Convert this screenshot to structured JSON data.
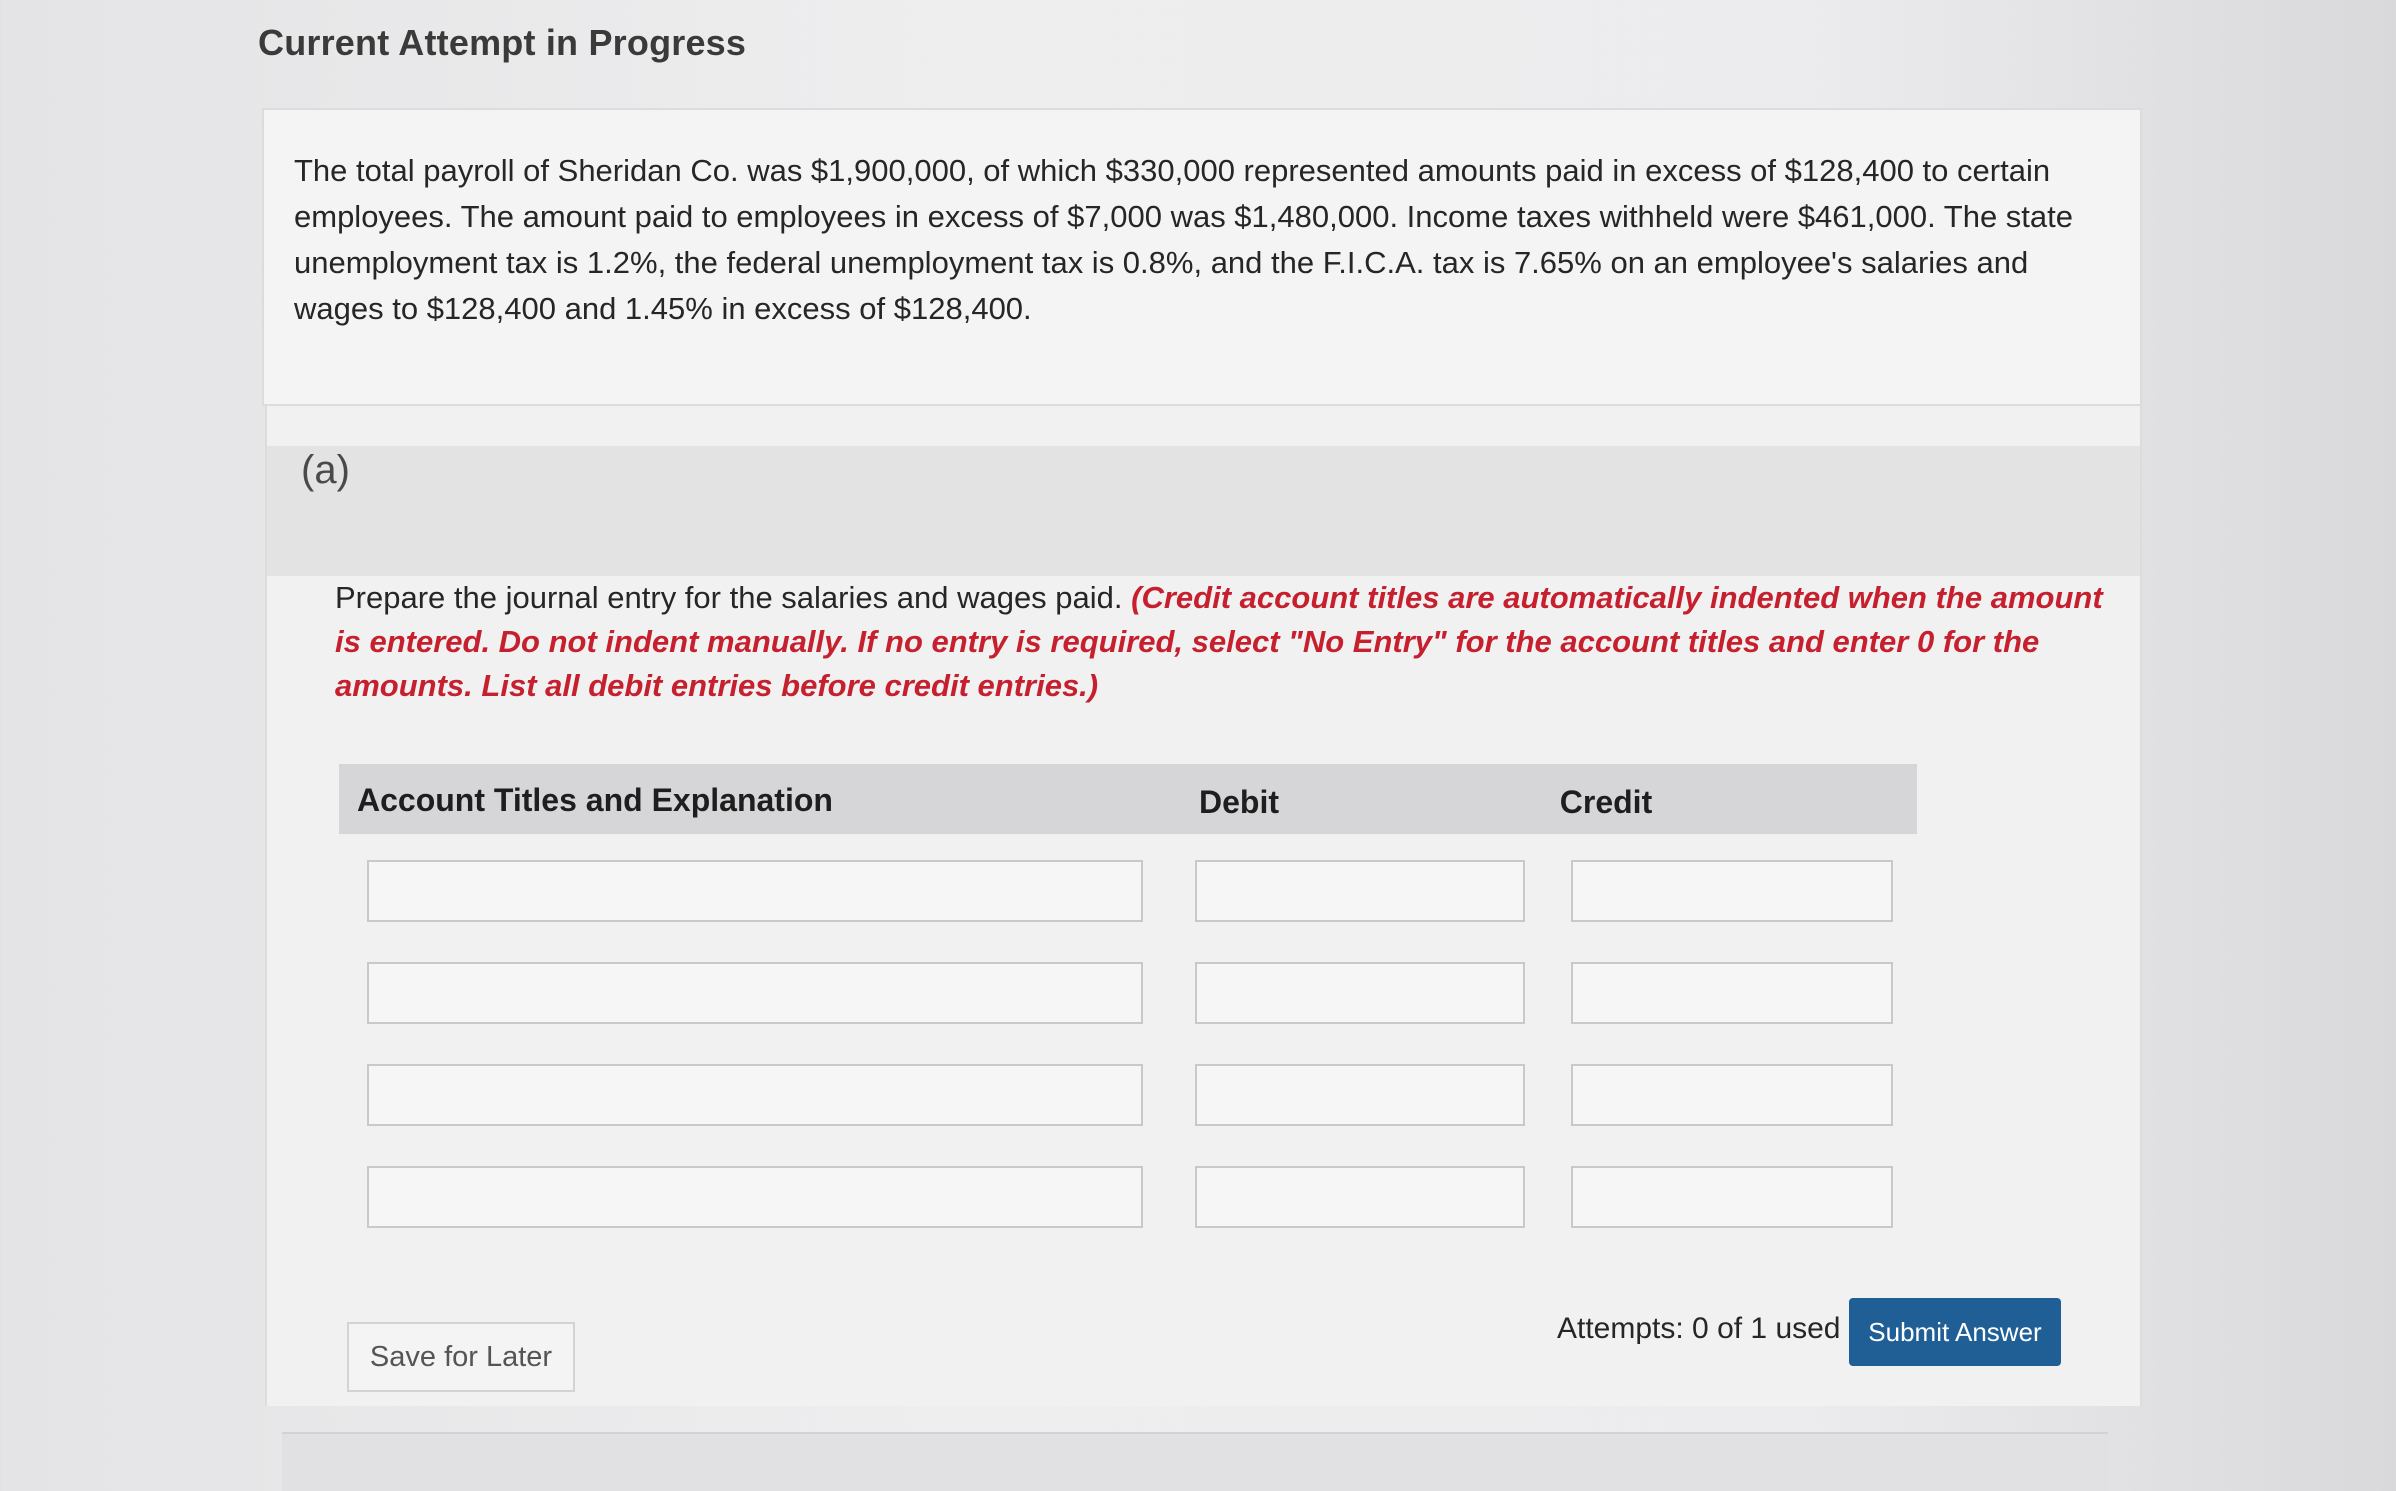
{
  "page": {
    "header": "Current Attempt in Progress"
  },
  "problem": {
    "text": "The total payroll of Sheridan Co. was $1,900,000, of which $330,000 represented amounts paid in excess of $128,400 to certain employees. The amount paid to employees in excess of $7,000 was $1,480,000. Income taxes withheld were $461,000. The state unemployment tax is 1.2%, the federal unemployment tax is 0.8%, and the F.I.C.A. tax is 7.65% on an employee's salaries and wages to $128,400 and 1.45% in excess of $128,400."
  },
  "part": {
    "label": "(a)",
    "instruction": "Prepare the journal entry for the salaries and wages paid.",
    "instruction_emphasis": "(Credit account titles are automatically indented when the amount is entered. Do not indent manually. If no entry is required, select \"No Entry\" for the account titles and enter 0 for the amounts. List all debit entries before credit entries.)",
    "emphasis_color": "#c6202e"
  },
  "table": {
    "headers": {
      "account": "Account Titles and Explanation",
      "debit": "Debit",
      "credit": "Credit"
    },
    "rows": [
      {
        "account": "",
        "debit": "",
        "credit": ""
      },
      {
        "account": "",
        "debit": "",
        "credit": ""
      },
      {
        "account": "",
        "debit": "",
        "credit": ""
      },
      {
        "account": "",
        "debit": "",
        "credit": ""
      }
    ]
  },
  "footer": {
    "save_label": "Save for Later",
    "attempts_label": "Attempts: 0 of 1 used",
    "submit_label": "Submit Answer",
    "submit_color": "#1f5f96"
  }
}
